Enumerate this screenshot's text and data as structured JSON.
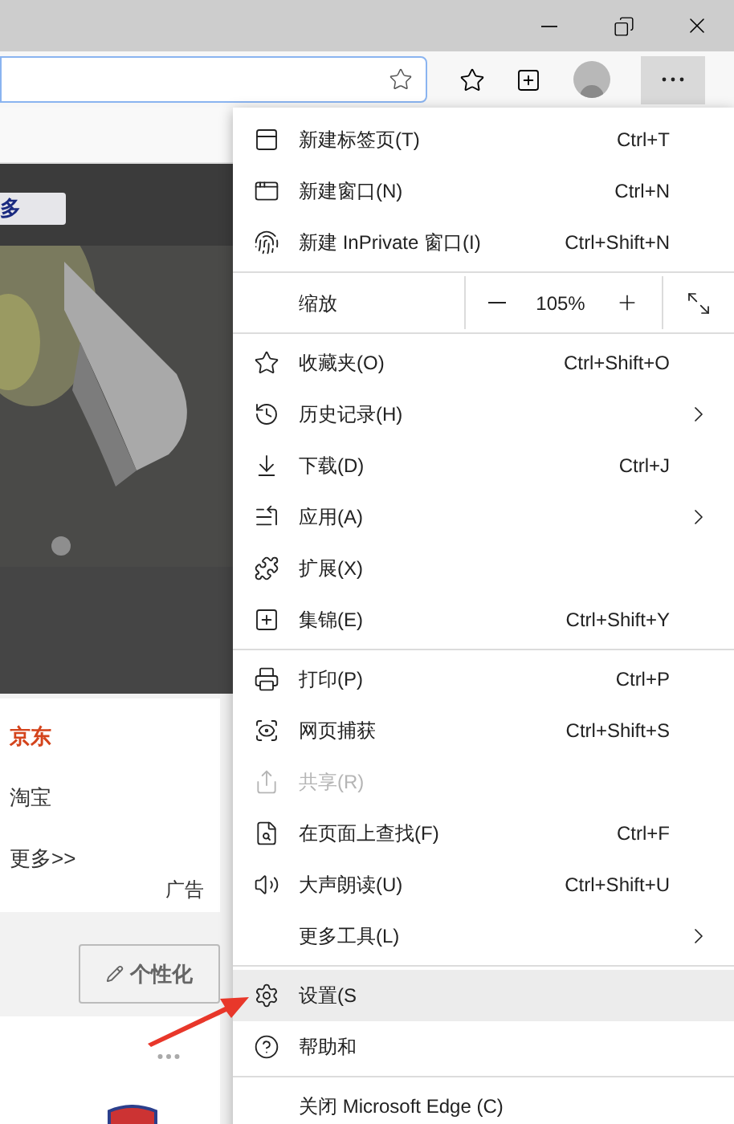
{
  "page": {
    "banner_button": "多",
    "links": [
      {
        "label": "京东",
        "color": "#d4441c"
      },
      {
        "label": "淘宝",
        "color": "#333333"
      },
      {
        "label": "更多>>",
        "color": "#333333"
      }
    ],
    "ad_label": "广告",
    "customize_button": "个性化"
  },
  "menu": {
    "items": [
      {
        "kind": "item",
        "label": "新建标签页(T)",
        "shortcut": "Ctrl+T",
        "submenu": false,
        "disabled": false,
        "selected": false
      },
      {
        "kind": "item",
        "label": "新建窗口(N)",
        "shortcut": "Ctrl+N",
        "submenu": false,
        "disabled": false,
        "selected": false
      },
      {
        "kind": "item",
        "label": "新建 InPrivate 窗口(I)",
        "shortcut": "Ctrl+Shift+N",
        "submenu": false,
        "disabled": false,
        "selected": false
      },
      {
        "kind": "separator"
      },
      {
        "kind": "zoom",
        "label": "缩放",
        "value": "105%"
      },
      {
        "kind": "separator"
      },
      {
        "kind": "item",
        "label": "收藏夹(O)",
        "shortcut": "Ctrl+Shift+O",
        "submenu": false,
        "disabled": false,
        "selected": false
      },
      {
        "kind": "item",
        "label": "历史记录(H)",
        "submenu": true,
        "disabled": false,
        "selected": false
      },
      {
        "kind": "item",
        "label": "下载(D)",
        "shortcut": "Ctrl+J",
        "submenu": false,
        "disabled": false,
        "selected": false
      },
      {
        "kind": "item",
        "label": "应用(A)",
        "submenu": true,
        "disabled": false,
        "selected": false
      },
      {
        "kind": "item",
        "label": "扩展(X)",
        "submenu": false,
        "disabled": false,
        "selected": false
      },
      {
        "kind": "item",
        "label": "集锦(E)",
        "shortcut": "Ctrl+Shift+Y",
        "submenu": false,
        "disabled": false,
        "selected": false
      },
      {
        "kind": "separator"
      },
      {
        "kind": "item",
        "label": "打印(P)",
        "shortcut": "Ctrl+P",
        "submenu": false,
        "disabled": false,
        "selected": false
      },
      {
        "kind": "item",
        "label": "网页捕获",
        "shortcut": "Ctrl+Shift+S",
        "submenu": false,
        "disabled": false,
        "selected": false
      },
      {
        "kind": "item",
        "label": "共享(R)",
        "submenu": false,
        "disabled": true,
        "selected": false
      },
      {
        "kind": "item",
        "label": "在页面上查找(F)",
        "shortcut": "Ctrl+F",
        "submenu": false,
        "disabled": false,
        "selected": false
      },
      {
        "kind": "item",
        "label": "大声朗读(U)",
        "shortcut": "Ctrl+Shift+U",
        "submenu": false,
        "disabled": false,
        "selected": false
      },
      {
        "kind": "item",
        "label": "更多工具(L)",
        "submenu": true,
        "disabled": false,
        "selected": false
      },
      {
        "kind": "separator"
      },
      {
        "kind": "item",
        "label": "设置(S",
        "submenu": false,
        "disabled": false,
        "selected": true
      },
      {
        "kind": "item",
        "label": "帮助和",
        "submenu": false,
        "disabled": false,
        "selected": false
      },
      {
        "kind": "separator"
      },
      {
        "kind": "item",
        "label": "关闭 Microsoft Edge (C)",
        "submenu": false,
        "disabled": false,
        "selected": false
      }
    ]
  }
}
